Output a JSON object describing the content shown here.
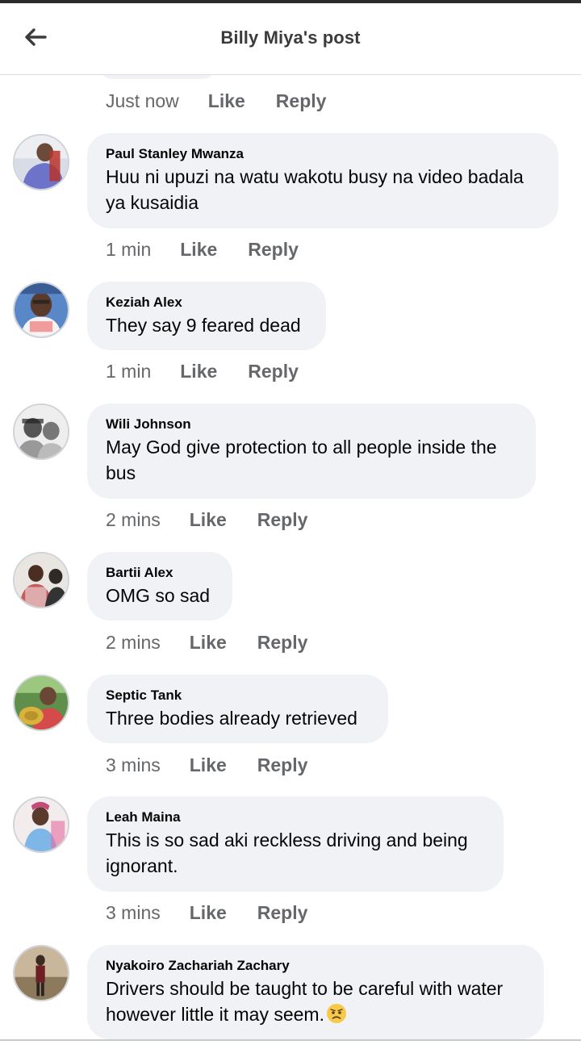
{
  "header": {
    "title": "Billy Miya's post"
  },
  "top_meta": {
    "time": "Just now",
    "like": "Like",
    "reply": "Reply"
  },
  "comments": [
    {
      "author": "Paul Stanley Mwanza",
      "text": "Huu ni upuzi na watu wakotu busy na video badala ya kusaidia",
      "time": "1 min",
      "like": "Like",
      "reply": "Reply"
    },
    {
      "author": "Keziah Alex",
      "text": "They say 9 feared dead",
      "time": "1 min",
      "like": "Like",
      "reply": "Reply"
    },
    {
      "author": "Wili Johnson",
      "text": "May God give protection to all people inside the bus",
      "time": "2 mins",
      "like": "Like",
      "reply": "Reply"
    },
    {
      "author": "Bartii Alex",
      "text": "OMG so sad",
      "time": "2 mins",
      "like": "Like",
      "reply": "Reply"
    },
    {
      "author": "Septic Tank",
      "text": "Three bodies already retrieved",
      "time": "3 mins",
      "like": "Like",
      "reply": "Reply"
    },
    {
      "author": "Leah Maina",
      "text": "This is so sad aki reckless driving and being ignorant.",
      "time": "3 mins",
      "like": "Like",
      "reply": "Reply"
    },
    {
      "author": "Nyakoiro Zachariah Zachary",
      "text": "Drivers should be taught to be careful with water however little it may seem.",
      "emoji": "worried-face-emoji"
    }
  ],
  "icons": {
    "back": "arrow-left-icon"
  },
  "colors": {
    "bubble": "#f0f2f5",
    "meta": "#65676b",
    "text": "#050505"
  }
}
